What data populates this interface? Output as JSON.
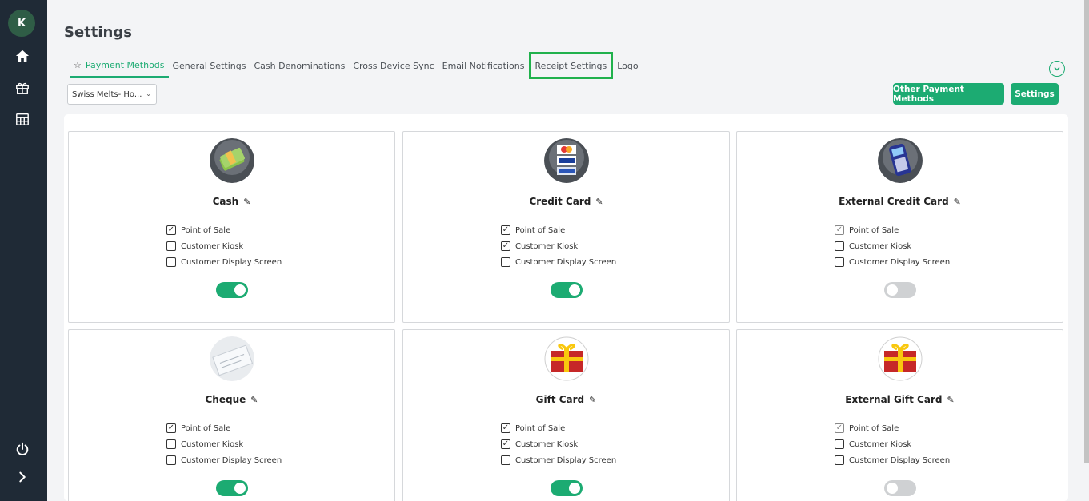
{
  "sidebar": {
    "avatar_initial": "K",
    "icons": [
      "home-icon",
      "gift-icon",
      "table-icon",
      "power-icon",
      "chevron-right-icon"
    ]
  },
  "page": {
    "title": "Settings"
  },
  "tabs": [
    {
      "label": "Payment Methods",
      "active": true
    },
    {
      "label": "General Settings"
    },
    {
      "label": "Cash Denominations"
    },
    {
      "label": "Cross Device Sync"
    },
    {
      "label": "Email Notifications"
    },
    {
      "label": "Receipt Settings",
      "highlighted": true
    },
    {
      "label": "Logo"
    }
  ],
  "store_select": {
    "value": "Swiss Melts- Ho..."
  },
  "buttons": {
    "other_payment_methods": "Other Payment Methods",
    "settings": "Settings"
  },
  "colors": {
    "accent": "#1cab72",
    "sidebar": "#1f2a36",
    "highlight": "#20b14c"
  },
  "checkbox_labels": [
    "Point of Sale",
    "Customer Kiosk",
    "Customer Display Screen"
  ],
  "payment_methods": [
    {
      "name": "Cash",
      "icon": "cash-icon",
      "checks": [
        true,
        false,
        false
      ],
      "enabled": true
    },
    {
      "name": "Credit Card",
      "icon": "credit-card-icon",
      "checks": [
        true,
        true,
        false
      ],
      "enabled": true
    },
    {
      "name": "External Credit Card",
      "icon": "card-terminal-icon",
      "checks": [
        true,
        false,
        false
      ],
      "enabled": false
    },
    {
      "name": "Cheque",
      "icon": "cheque-icon",
      "checks": [
        true,
        false,
        false
      ],
      "enabled": true
    },
    {
      "name": "Gift Card",
      "icon": "gift-card-icon",
      "checks": [
        true,
        true,
        false
      ],
      "enabled": true
    },
    {
      "name": "External Gift Card",
      "icon": "gift-card-icon",
      "checks": [
        true,
        false,
        false
      ],
      "enabled": false
    }
  ]
}
